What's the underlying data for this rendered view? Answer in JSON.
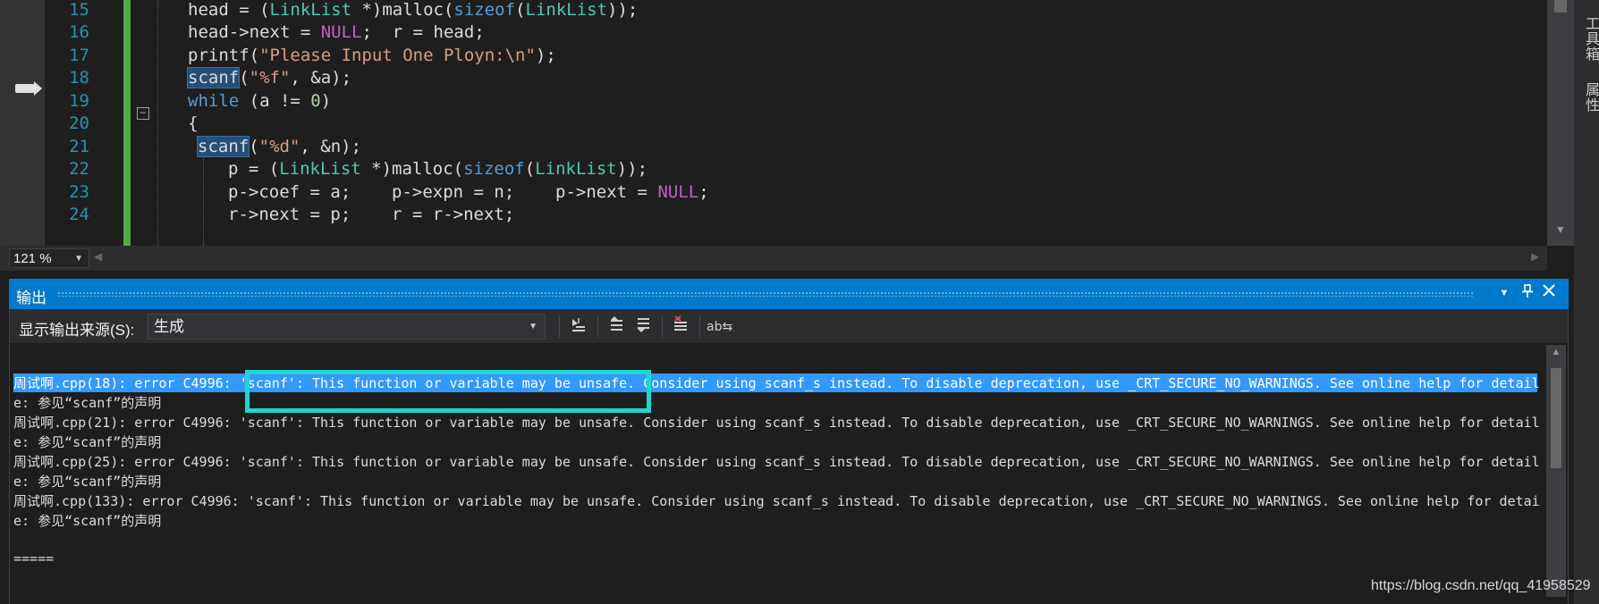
{
  "editor": {
    "line_numbers": [
      "15",
      "16",
      "17",
      "18",
      "19",
      "20",
      "21",
      "22",
      "23",
      "24"
    ],
    "zoom": "121 %"
  },
  "side_tabs": {
    "toolbox": "工具箱",
    "properties": "属性"
  },
  "output": {
    "title": "输出",
    "source_label": "显示输出来源(S):",
    "source_value": "生成",
    "lines": [
      "周试啊.cpp(18): error C4996: 'scanf': This function or variable may be unsafe. Consider using scanf_s instead. To disable deprecation, use _CRT_SECURE_NO_WARNINGS. See online help for detail",
      "e: 参见“scanf”的声明",
      "周试啊.cpp(21): error C4996: 'scanf': This function or variable may be unsafe. Consider using scanf_s instead. To disable deprecation, use _CRT_SECURE_NO_WARNINGS. See online help for detail",
      "e: 参见“scanf”的声明",
      "周试啊.cpp(25): error C4996: 'scanf': This function or variable may be unsafe. Consider using scanf_s instead. To disable deprecation, use _CRT_SECURE_NO_WARNINGS. See online help for detail",
      "e: 参见“scanf”的声明",
      "周试啊.cpp(133): error C4996: 'scanf': This function or variable may be unsafe. Consider using scanf_s instead. To disable deprecation, use _CRT_SECURE_NO_WARNINGS. See online help for detai",
      "e: 参见“scanf”的声明",
      "",
      "====="
    ]
  },
  "watermark": "https://blog.csdn.net/qq_41958529"
}
